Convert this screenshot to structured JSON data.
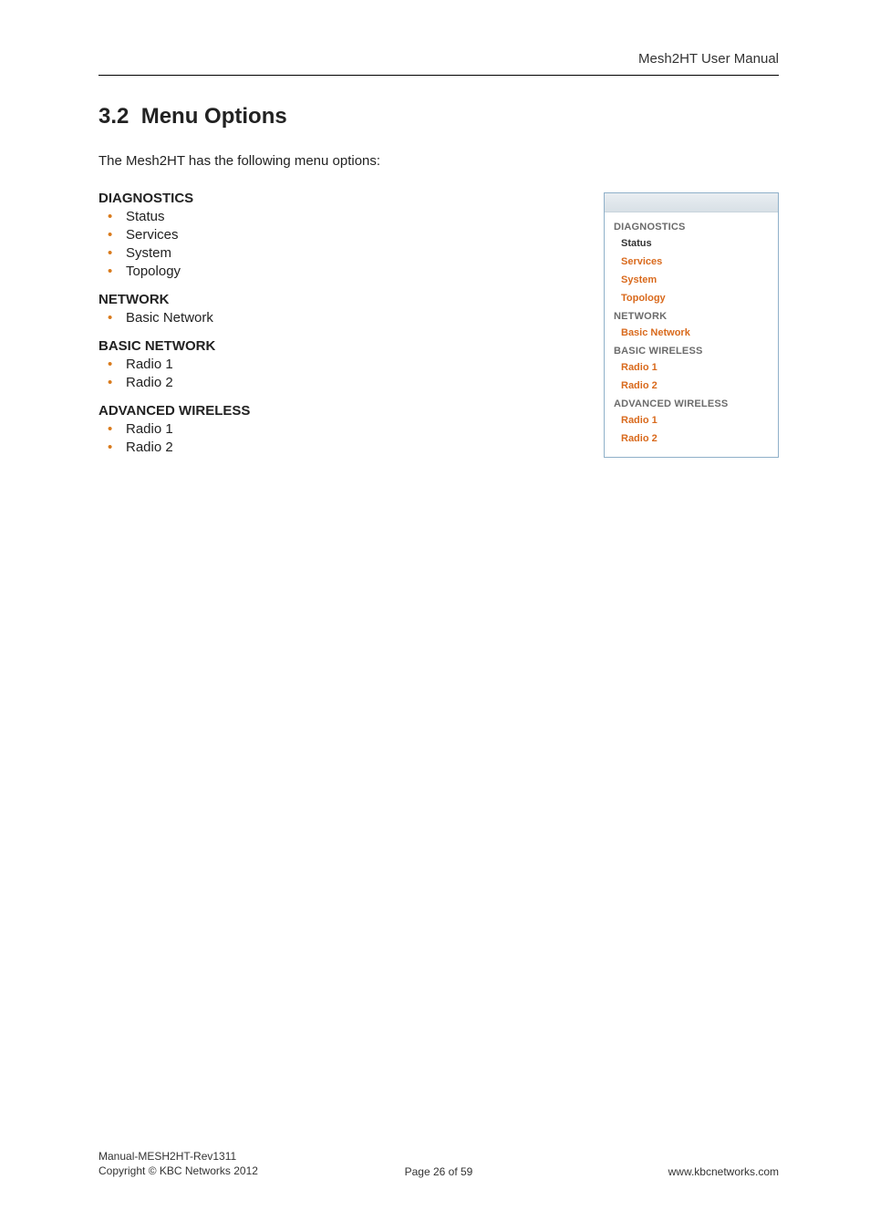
{
  "header": {
    "right": "Mesh2HT User Manual"
  },
  "section": {
    "number": "3.2",
    "title": "Menu Options"
  },
  "intro": "The Mesh2HT has the following menu options:",
  "categories": [
    {
      "heading": "DIAGNOSTICS",
      "items": [
        "Status",
        "Services",
        "System",
        "Topology"
      ]
    },
    {
      "heading": "NETWORK",
      "items": [
        "Basic Network"
      ]
    },
    {
      "heading": "BASIC NETWORK",
      "items": [
        "Radio 1",
        "Radio 2"
      ]
    },
    {
      "heading": "ADVANCED WIRELESS",
      "items": [
        "Radio 1",
        "Radio 2"
      ]
    }
  ],
  "panel": {
    "groups": [
      {
        "header": "DIAGNOSTICS",
        "items": [
          {
            "label": "Status",
            "style": "dark"
          },
          {
            "label": "Services",
            "style": "orange"
          },
          {
            "label": "System",
            "style": "orange"
          },
          {
            "label": "Topology",
            "style": "orange"
          }
        ]
      },
      {
        "header": "NETWORK",
        "items": [
          {
            "label": "Basic Network",
            "style": "orange"
          }
        ]
      },
      {
        "header": "BASIC WIRELESS",
        "items": [
          {
            "label": "Radio 1",
            "style": "orange"
          },
          {
            "label": "Radio 2",
            "style": "orange"
          }
        ]
      },
      {
        "header": "ADVANCED WIRELESS",
        "items": [
          {
            "label": "Radio 1",
            "style": "orange"
          },
          {
            "label": "Radio 2",
            "style": "orange"
          }
        ]
      }
    ]
  },
  "footer": {
    "line1": "Manual-MESH2HT-Rev1311",
    "line2": "Copyright © KBC Networks 2012",
    "center": "Page 26 of 59",
    "right": "www.kbcnetworks.com"
  }
}
